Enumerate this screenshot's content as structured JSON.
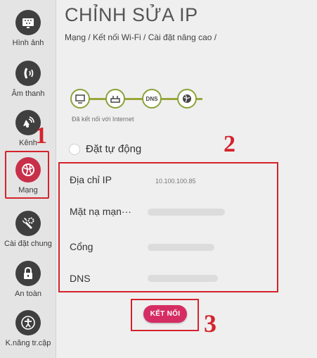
{
  "sidebar": {
    "items": [
      {
        "label": "Hình ảnh",
        "icon": "picture-icon"
      },
      {
        "label": "Âm thanh",
        "icon": "sound-icon"
      },
      {
        "label": "Kênh",
        "icon": "channel-icon"
      },
      {
        "label": "Mạng",
        "icon": "network-icon"
      },
      {
        "label": "Cài đặt chung",
        "icon": "wrench-gear-icon"
      },
      {
        "label": "An toàn",
        "icon": "lock-icon"
      },
      {
        "label": "K.năng tr.cập",
        "icon": "accessibility-icon"
      }
    ],
    "active_index": 3,
    "active_color": "#c8304a"
  },
  "header": {
    "title": "CHỈNH SỬA IP",
    "breadcrumb": "Mạng / Kết nối Wi-Fi / Cài đặt nâng cao /"
  },
  "connection": {
    "nodes": [
      "tv-icon",
      "router-icon",
      "DNS",
      "globe-icon"
    ],
    "status": "Đã kết nối với Internet",
    "line_color": "#9aa63a"
  },
  "form": {
    "auto_label": "Đặt tự động",
    "fields": [
      {
        "label": "Địa chỉ IP",
        "value": "10.100.100.85"
      },
      {
        "label": "Mặt nạ mạn···",
        "value": ""
      },
      {
        "label": "Cổng",
        "value": ""
      },
      {
        "label": "DNS",
        "value": ""
      }
    ]
  },
  "connect_button": {
    "label": "KẾT NỐI",
    "color": "#d52d63"
  },
  "annotations": {
    "step1": "1",
    "step2": "2",
    "step3": "3",
    "color": "#d4232c"
  }
}
